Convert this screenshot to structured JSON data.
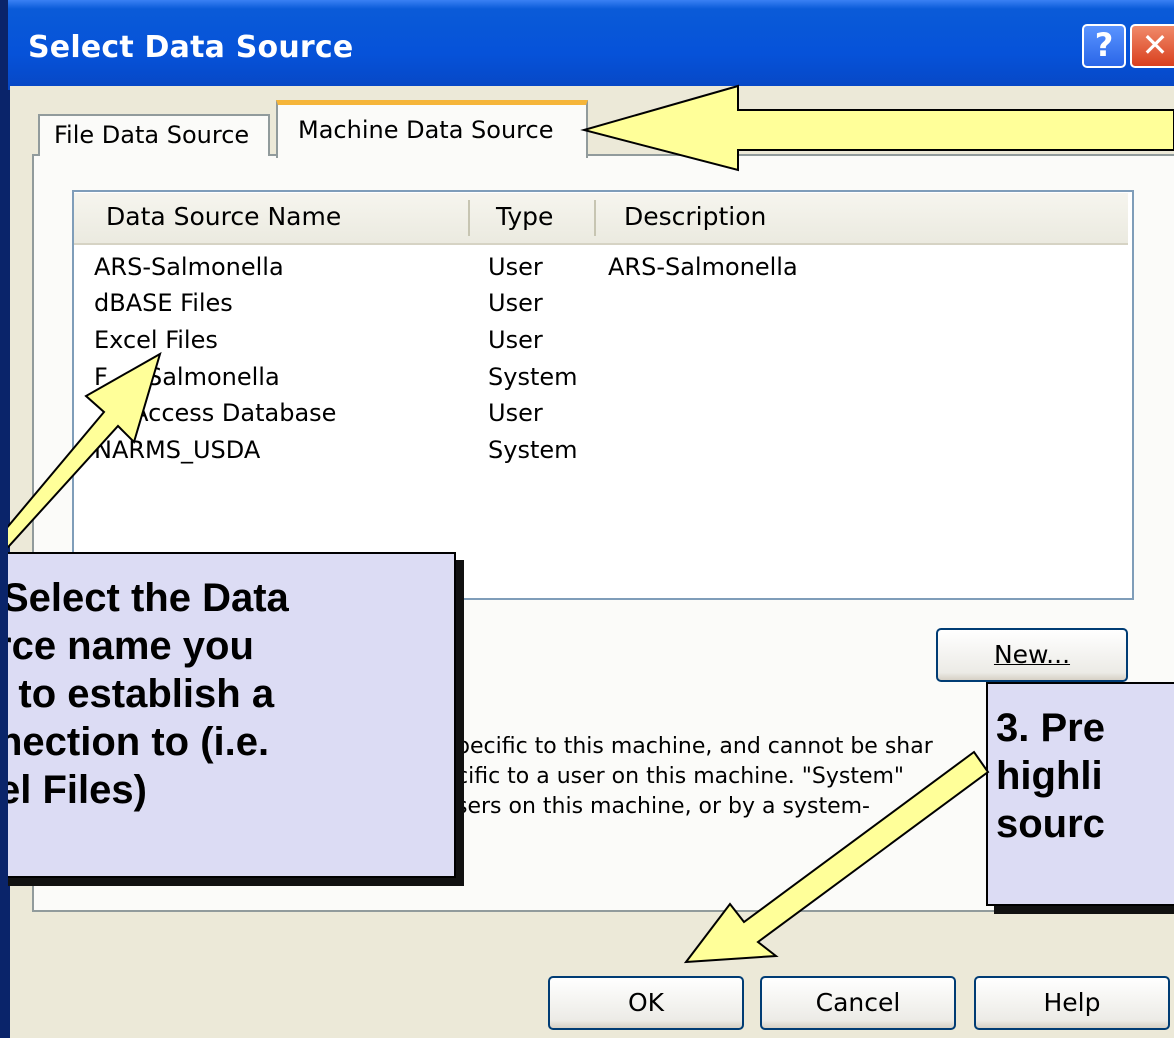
{
  "window": {
    "title": "Select Data Source",
    "help_glyph": "?",
    "close_glyph": "✕"
  },
  "tabs": [
    {
      "label": "File Data Source",
      "active": false
    },
    {
      "label": "Machine Data Source",
      "active": true
    }
  ],
  "list": {
    "columns": [
      "Data Source Name",
      "Type",
      "Description"
    ],
    "rows": [
      {
        "name": "ARS-Salmonella",
        "type": "User",
        "description": "ARS-Salmonella"
      },
      {
        "name": "dBASE Files",
        "type": "User",
        "description": ""
      },
      {
        "name": "Excel Files",
        "type": "User",
        "description": ""
      },
      {
        "name": "F    -Salmonella",
        "type": "System",
        "description": ""
      },
      {
        "name": "     Access Database",
        "type": "User",
        "description": ""
      },
      {
        "name": "NARMS_USDA",
        "type": "System",
        "description": ""
      }
    ]
  },
  "buttons": {
    "new": "New...",
    "ok": "OK",
    "cancel": "Cancel",
    "help": "Help"
  },
  "description_lines": [
    "pecific to this machine, and cannot be shar",
    "cific to a user on this machine.  \"System\"",
    "sers on this machine, or by a system-"
  ],
  "callouts": {
    "left": [
      "Select the Data",
      "rce name you",
      "t to establish a",
      "nection to (i.e.",
      "el Files)"
    ],
    "right": [
      "3.  Pre",
      "highli",
      "sourc"
    ]
  },
  "colors": {
    "titlebar": "#0652d9",
    "dialog_face": "#ece9d8",
    "callout_fill": "#dcdcf4",
    "arrow_fill": "#ffff99",
    "tab_highlight": "#f5b53a"
  }
}
